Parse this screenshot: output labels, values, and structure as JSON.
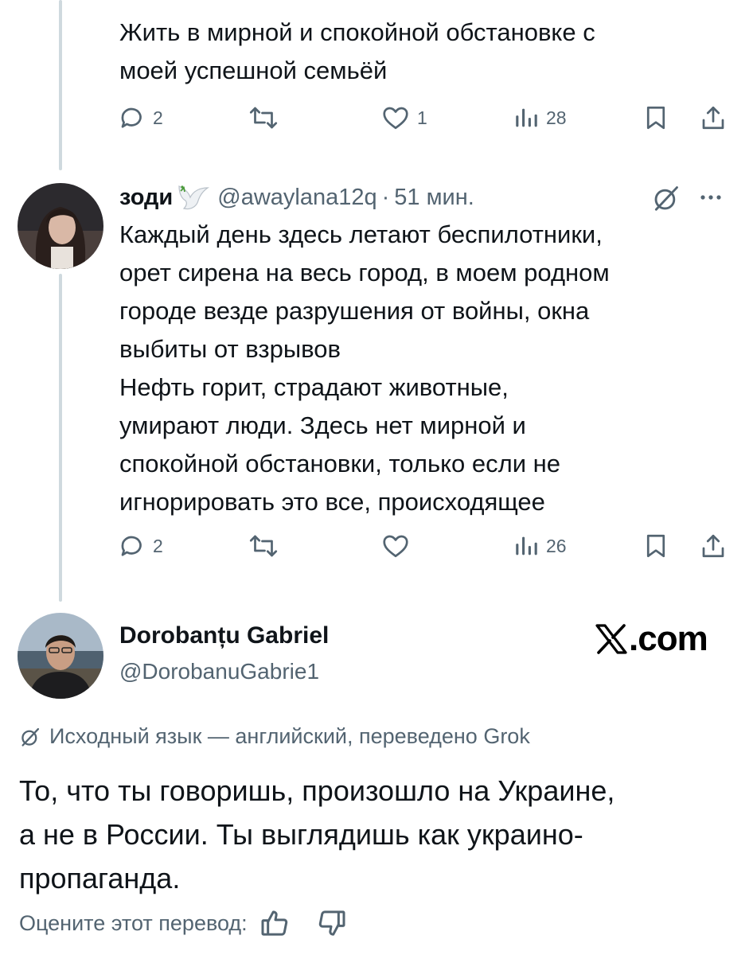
{
  "tweet1": {
    "text": "Жить в мирной и спокойной обстановке с\nмоей успешной семьёй",
    "replies": "2",
    "retweets": "",
    "likes": "1",
    "views": "28"
  },
  "tweet2": {
    "name": "зоди",
    "name_emoji": "dove-icon",
    "handle": "@awaylana12q",
    "separator": "·",
    "time": "51 мин.",
    "text": "Каждый день здесь летают беспилотники,\nорет сирена на весь город, в моем родном\nгороде везде разрушения от войны, окна\nвыбиты от взрывов\nНефть горит, страдают животные,\nумирают люди. Здесь нет мирной и\nспокойной обстановки, только если не\nигнорировать это все, происходящее",
    "replies": "2",
    "retweets": "",
    "likes": "",
    "views": "26"
  },
  "reply": {
    "name": "Dorobanțu Gabriel",
    "handle": "@DorobanuGabrie1",
    "site": ".com",
    "translation_note": "Исходный язык — английский, переведено Grok",
    "text": "То, что ты говоришь, произошло на Украине,\nа не в России. Ты выглядишь как украино-\nпропаганда.",
    "rate_label": "Оцените этот перевод:"
  },
  "colors": {
    "text": "#0f1419",
    "secondary": "#536471",
    "thread_line": "#cfd9de"
  }
}
